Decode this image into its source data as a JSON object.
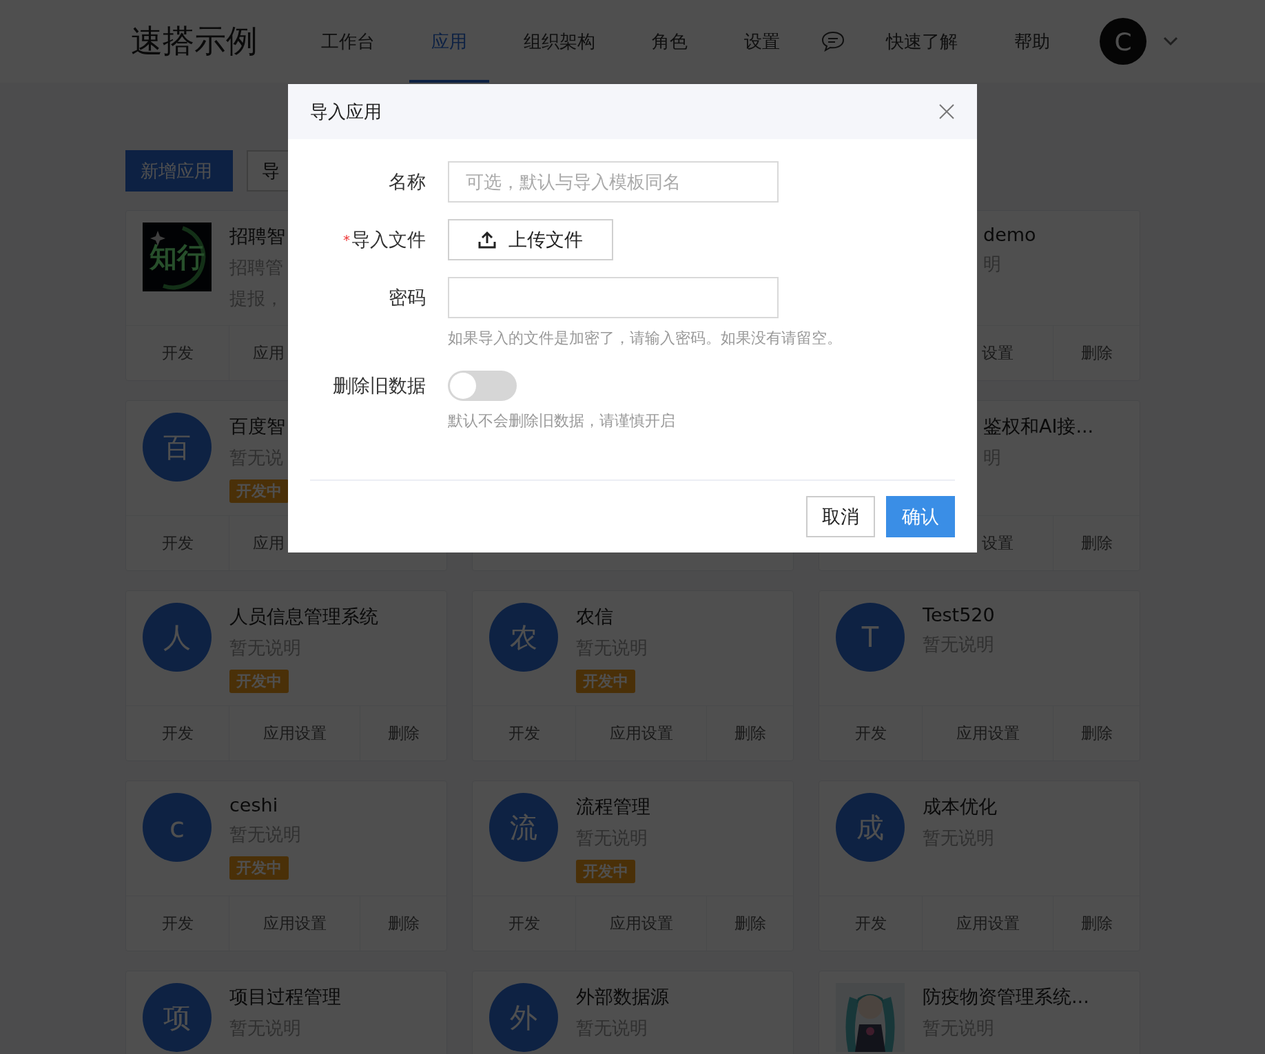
{
  "header": {
    "logo": "速搭示例",
    "nav": [
      {
        "kind": "tab",
        "label": "工作台",
        "selected": false
      },
      {
        "kind": "tab",
        "label": "应用",
        "selected": true
      },
      {
        "kind": "tab",
        "label": "组织架构",
        "selected": false
      },
      {
        "kind": "tab",
        "label": "角色",
        "selected": false
      },
      {
        "kind": "tab",
        "label": "设置",
        "selected": false
      },
      {
        "kind": "chat",
        "selected": false
      },
      {
        "kind": "tab",
        "label": "快速了解",
        "selected": false
      },
      {
        "kind": "tab",
        "label": "帮助",
        "selected": false
      }
    ],
    "user": {
      "initial": "C"
    }
  },
  "toolbar": [
    {
      "kind": "primary",
      "label": "新增应用"
    },
    {
      "kind": "default",
      "label": "导"
    }
  ],
  "apps": [
    {
      "kind": "cut_right",
      "avatar": {
        "kind": "logo",
        "text": "知行"
      },
      "title": "招聘智",
      "description_lines": [
        "招聘管",
        "提报，"
      ],
      "actions": [
        "开发",
        "应用"
      ]
    },
    {
      "kind": "covered"
    },
    {
      "kind": "cut_left",
      "title": "demo",
      "description_lines": [
        "明"
      ],
      "actions": [
        "设置",
        "删除"
      ]
    },
    {
      "kind": "cut_right",
      "avatar": {
        "kind": "letter",
        "text": "百"
      },
      "title": "百度智",
      "description_lines": [
        "暂无说"
      ],
      "status": "开发中",
      "actions": [
        "开发",
        "应用"
      ]
    },
    {
      "kind": "edge"
    },
    {
      "kind": "cut_left",
      "title": "鉴权和AI接...",
      "description_lines": [
        "明"
      ],
      "actions": [
        "设置",
        "删除"
      ]
    },
    {
      "kind": "full",
      "avatar": {
        "kind": "letter",
        "text": "人"
      },
      "title": "人员信息管理系统",
      "description_lines": [
        "暂无说明"
      ],
      "status": "开发中",
      "actions": [
        "开发",
        "应用设置",
        "删除"
      ]
    },
    {
      "kind": "full",
      "avatar": {
        "kind": "letter",
        "text": "农"
      },
      "title": "农信",
      "description_lines": [
        "暂无说明"
      ],
      "status": "开发中",
      "actions": [
        "开发",
        "应用设置",
        "删除"
      ]
    },
    {
      "kind": "full",
      "avatar": {
        "kind": "letter",
        "text": "T"
      },
      "title": "Test520",
      "description_lines": [
        "暂无说明"
      ],
      "actions": [
        "开发",
        "应用设置",
        "删除"
      ]
    },
    {
      "kind": "full",
      "avatar": {
        "kind": "letter",
        "text": "c"
      },
      "title": "ceshi",
      "description_lines": [
        "暂无说明"
      ],
      "status": "开发中",
      "actions": [
        "开发",
        "应用设置",
        "删除"
      ]
    },
    {
      "kind": "full",
      "avatar": {
        "kind": "letter",
        "text": "流"
      },
      "title": "流程管理",
      "description_lines": [
        "暂无说明"
      ],
      "status": "开发中",
      "actions": [
        "开发",
        "应用设置",
        "删除"
      ]
    },
    {
      "kind": "full",
      "avatar": {
        "kind": "letter",
        "text": "成"
      },
      "title": "成本优化",
      "description_lines": [
        "暂无说明"
      ],
      "actions": [
        "开发",
        "应用设置",
        "删除"
      ]
    },
    {
      "kind": "full",
      "avatar": {
        "kind": "letter",
        "text": "项"
      },
      "title": "项目过程管理",
      "description_lines": [
        "暂无说明"
      ]
    },
    {
      "kind": "full",
      "avatar": {
        "kind": "letter",
        "text": "外"
      },
      "title": "外部数据源",
      "description_lines": [
        "暂无说明"
      ]
    },
    {
      "kind": "full",
      "avatar": {
        "kind": "picture"
      },
      "title": "防疫物资管理系统...",
      "description_lines": [
        "暂无说明"
      ]
    }
  ],
  "dialog": {
    "title": "导入应用",
    "fields": [
      {
        "kind": "text",
        "label": "名称",
        "placeholder": "可选，默认与导入模板同名"
      },
      {
        "kind": "upload",
        "label": "导入文件",
        "required_mark": "*",
        "button": "上传文件"
      },
      {
        "kind": "password",
        "label": "密码",
        "hint": "如果导入的文件是加密了，请输入密码。如果没有请留空。"
      },
      {
        "kind": "switch",
        "label": "删除旧数据",
        "on": false,
        "hint": "默认不会删除旧数据，请谨慎开启"
      }
    ],
    "buttons": [
      {
        "kind": "default",
        "label": "取消"
      },
      {
        "kind": "primary",
        "label": "确认"
      }
    ]
  }
}
